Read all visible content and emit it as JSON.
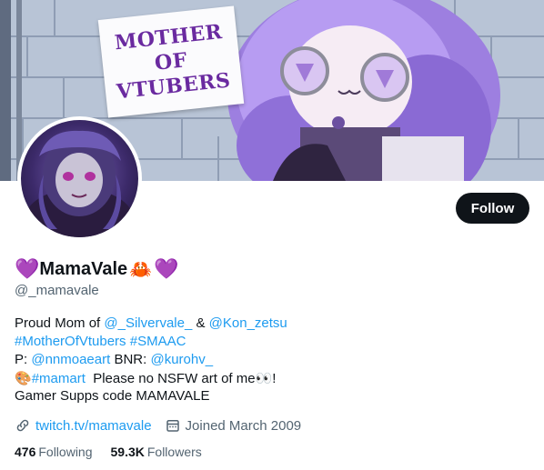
{
  "banner": {
    "sign_lines": [
      "MOTHER",
      "OF",
      "VTUBERS"
    ]
  },
  "profile": {
    "display_name": "MamaVale",
    "name_emoji_left": "💜",
    "name_emoji_crab": "🦀",
    "name_emoji_right": "💜",
    "handle": "@_mamavale",
    "follow_label": "Follow"
  },
  "bio": {
    "l1_a": "Proud Mom of ",
    "l1_link1": "@_Silvervale_",
    "l1_b": " & ",
    "l1_link2": "@Kon_zetsu",
    "l2_tag1": "#MotherOfVtubers",
    "l2_tag2": "#SMAAC",
    "l3_a": "P: ",
    "l3_link1": "@nnmoaeart",
    "l3_b": " BNR: ",
    "l3_link2": "@kurohv_",
    "l4_emoji": "🎨",
    "l4_tag": "#mamart",
    "l4_text": "  Please no NSFW art of me",
    "l4_eyes": "👀",
    "l4_end": "!",
    "l5": "Gamer Supps code MAMAVALE"
  },
  "meta": {
    "website": "twitch.tv/mamavale",
    "joined": "Joined March 2009",
    "link_icon": "link-icon",
    "calendar_icon": "calendar-icon"
  },
  "stats": {
    "following_count": "476",
    "following_label": "Following",
    "followers_count": "59.3K",
    "followers_label": "Followers"
  },
  "colors": {
    "link": "#1d9bf0",
    "text": "#0f1419",
    "muted": "#536471",
    "button": "#0f1419"
  }
}
